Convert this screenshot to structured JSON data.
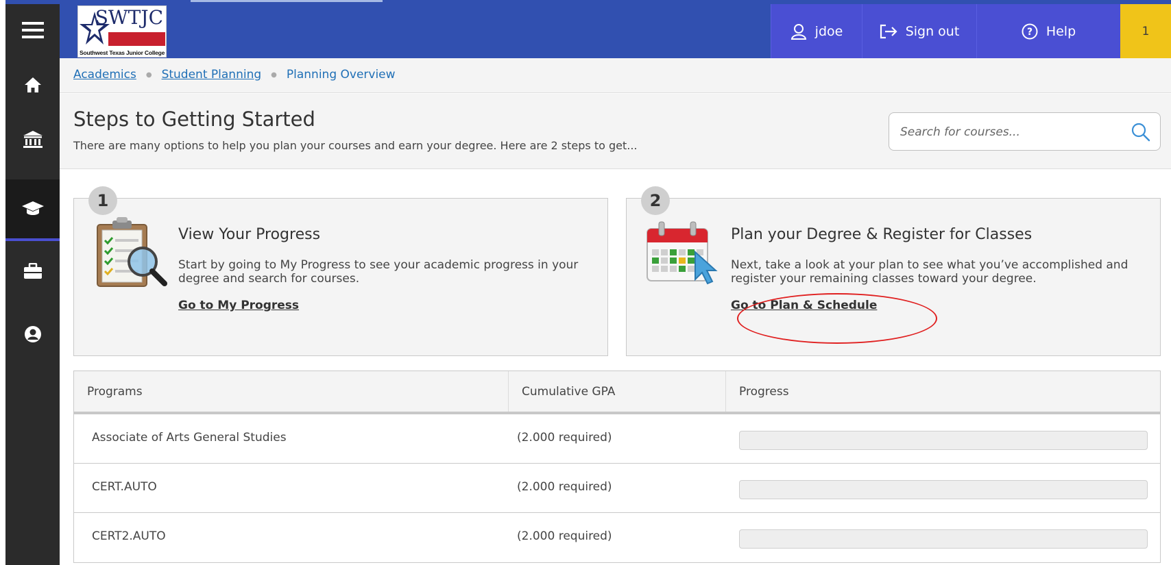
{
  "header": {
    "logo_text": "SWTJC",
    "logo_sub": "Southwest Texas Junior College",
    "user_label": "jdoe",
    "signout_label": "Sign out",
    "help_label": "Help",
    "alert_count": "1"
  },
  "sidebar": {
    "items": [
      {
        "icon": "menu-icon"
      },
      {
        "icon": "home-icon"
      },
      {
        "icon": "bank-icon"
      },
      {
        "icon": "graduation-cap-icon",
        "active": true
      },
      {
        "icon": "briefcase-icon"
      },
      {
        "icon": "user-circle-icon"
      }
    ]
  },
  "breadcrumb": {
    "items": [
      "Academics",
      "Student Planning"
    ],
    "current": "Planning Overview"
  },
  "page": {
    "title": "Steps to Getting Started",
    "subtitle": "There are many options to help you plan your courses and earn your degree. Here are 2 steps to get..."
  },
  "search": {
    "placeholder": "Search for courses..."
  },
  "steps": [
    {
      "number": "1",
      "title": "View Your Progress",
      "text": "Start by going to My Progress to see your academic progress in your degree and search for courses.",
      "link": "Go to My Progress"
    },
    {
      "number": "2",
      "title": "Plan your Degree & Register for Classes",
      "text": "Next, take a look at your plan to see what you’ve accomplished and register your remaining classes toward your degree.",
      "link": "Go to Plan & Schedule"
    }
  ],
  "programs_table": {
    "headers": [
      "Programs",
      "Cumulative GPA",
      "Progress"
    ],
    "rows": [
      {
        "program": "Associate of Arts General Studies",
        "gpa": "(2.000 required)",
        "progress": 0
      },
      {
        "program": "CERT.AUTO",
        "gpa": "(2.000 required)",
        "progress": 0
      },
      {
        "program": "CERT2.AUTO",
        "gpa": "(2.000 required)",
        "progress": 0
      }
    ]
  },
  "colors": {
    "header_blue": "#3150b0",
    "header_button": "#4a4fd3",
    "alert_yellow": "#f0c419",
    "sidebar_dark": "#2b2b2b",
    "link_blue": "#1f6fb6",
    "annotation_red": "#e02020"
  }
}
